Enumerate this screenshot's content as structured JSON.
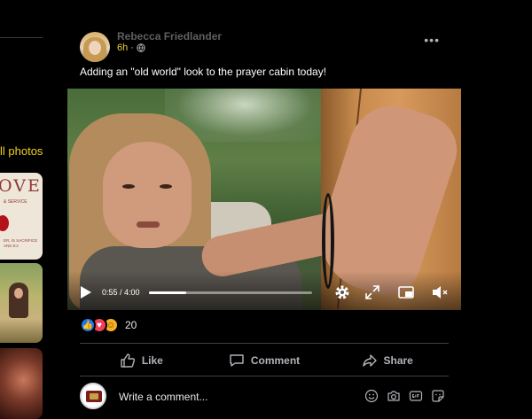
{
  "sidebar": {
    "all_photos_label": "ll photos",
    "thumb1_title": "OVE",
    "thumb1_subtitle": "& SERVICE",
    "thumb1_caption_line1": "ER, IS SACRIFICE",
    "thumb1_caption_line2": "ANS 8:2"
  },
  "post": {
    "author": "Rebecca Friedlander",
    "timestamp": "6h",
    "separator": "·",
    "caption": "Adding an \"old world\" look to the prayer cabin today!",
    "more_icon": "more-dots-icon",
    "privacy_icon": "globe-icon"
  },
  "video": {
    "current_time": "0:55",
    "duration": "4:00",
    "time_display": "0:55 / 4:00",
    "progress": 0.229,
    "controls": [
      "play-icon",
      "settings-icon",
      "fullscreen-icon",
      "picture-in-picture-icon",
      "mute-icon"
    ]
  },
  "reactions": {
    "types": [
      "like",
      "love",
      "care"
    ],
    "count": "20"
  },
  "actions": {
    "like_label": "Like",
    "comment_label": "Comment",
    "share_label": "Share"
  },
  "comment_box": {
    "placeholder": "Write a comment...",
    "tools": [
      "emoji-icon",
      "camera-icon",
      "gif-icon",
      "sticker-icon"
    ]
  },
  "colors": {
    "background": "#000000",
    "accent_yellow": "#f2d21a",
    "like_blue": "#1877f2",
    "text_secondary": "#b0b3b8"
  }
}
